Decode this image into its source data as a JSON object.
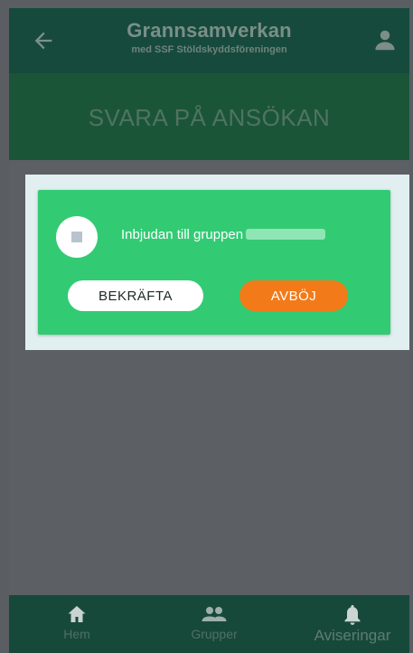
{
  "header": {
    "title": "Grannsamverkan",
    "subtitle": "med SSF Stöldskyddsföreningen"
  },
  "banner": {
    "title": "SVARA PÅ ANSÖKAN"
  },
  "invite": {
    "message": "Inbjudan till gruppen",
    "confirm_label": "BEKRÄFTA",
    "decline_label": "AVBÖJ"
  },
  "bottom_nav": {
    "items": [
      {
        "label": "Hem",
        "icon": "home-icon"
      },
      {
        "label": "Grupper",
        "icon": "group-icon"
      },
      {
        "label": "Aviseringar",
        "icon": "bell-icon"
      }
    ]
  },
  "colors": {
    "header": "#164a3c",
    "banner": "#1b5537",
    "card": "#32cb74",
    "decline": "#f27a19",
    "overlay": "#5c6065"
  }
}
